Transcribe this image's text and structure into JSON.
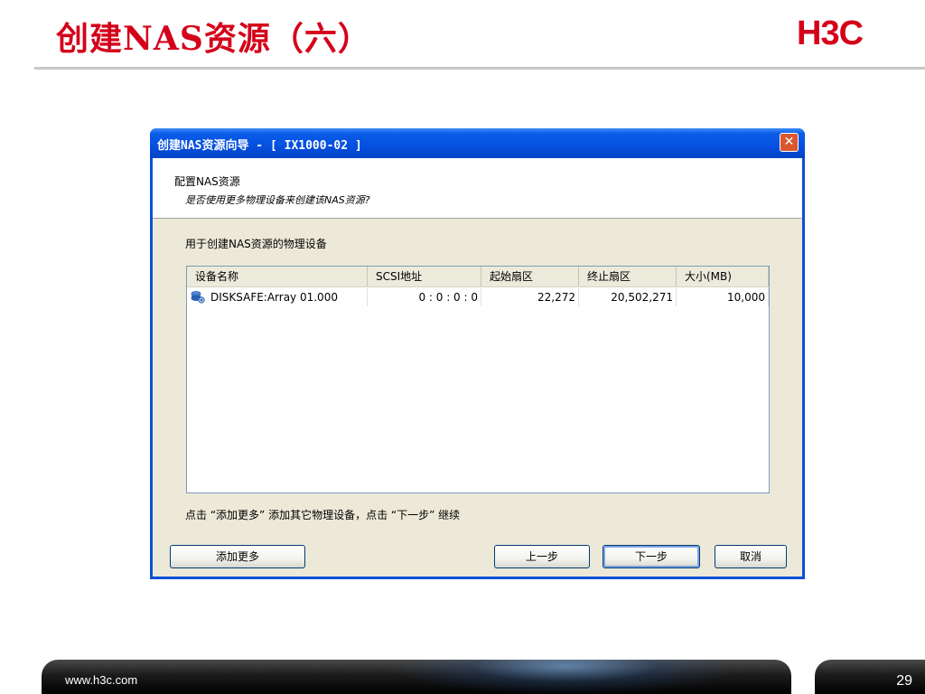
{
  "slide": {
    "title": "创建NAS资源（六）",
    "logo": "H3C",
    "footer_url": "www.h3c.com",
    "page_number": "29"
  },
  "dialog": {
    "title": "创建NAS资源向导 - [ IX1000-02 ]",
    "close_label": "✕",
    "banner_title": "配置NAS资源",
    "banner_subtitle": "是否使用更多物理设备来创建该NAS资源?",
    "list_caption": "用于创建NAS资源的物理设备",
    "columns": [
      "设备名称",
      "SCSI地址",
      "起始扇区",
      "终止扇区",
      "大小(MB)"
    ],
    "rows": [
      {
        "icon": "disk-icon",
        "name": "DISKSAFE:Array 01.000",
        "scsi": "0 : 0 : 0 : 0",
        "start_sector": "22,272",
        "end_sector": "20,502,271",
        "size": "10,000"
      }
    ],
    "hint": "点击 “添加更多” 添加其它物理设备，点击 “下一步” 继续",
    "buttons": {
      "add_more": "添加更多",
      "back": "上一步",
      "next": "下一步",
      "cancel": "取消"
    }
  },
  "colors": {
    "title_red": "#d4001a",
    "titlebar_blue": "#0550e0",
    "dialog_face": "#ece9d8"
  }
}
